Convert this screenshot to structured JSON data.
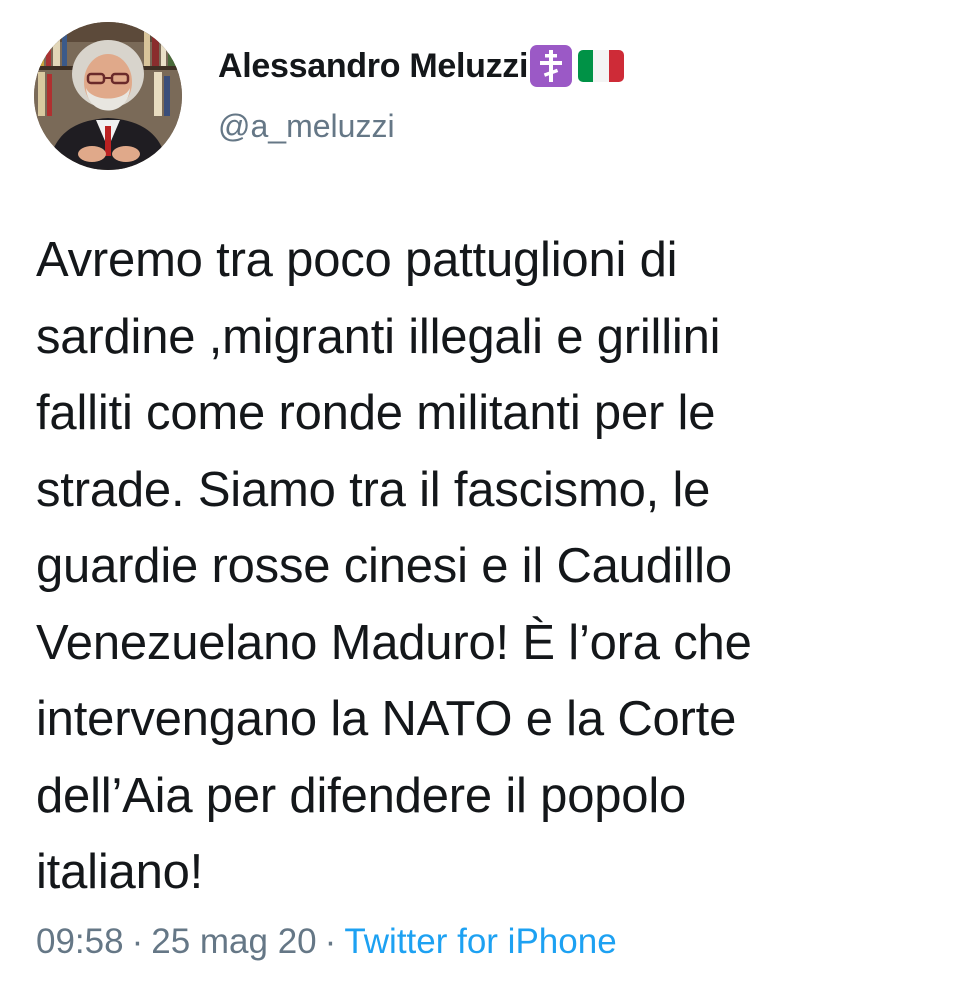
{
  "author": {
    "display_name": "Alessandro Meluzzi",
    "handle": "@a_meluzzi",
    "badges": [
      "orthodox-cross-emoji",
      "italy-flag-emoji"
    ]
  },
  "tweet": {
    "text": "Avremo tra poco pattuglioni di\nsardine ,migranti illegali e grillini\nfalliti come ronde militanti per le\nstrade. Siamo tra il fascismo, le\nguardie rosse cinesi e il Caudillo\nVenezuelano Maduro! È l’ora che\nintervengano la NATO e la Corte\ndell’Aia per difendere il popolo\nitaliano!"
  },
  "meta": {
    "time": "09:58",
    "separator": "·",
    "date": "25 mag 20",
    "source": "Twitter for iPhone"
  },
  "colors": {
    "text": "#14171a",
    "secondary": "#657786",
    "link": "#1da1f2",
    "cross_badge": "#9b59c6",
    "flag_green": "#009246",
    "flag_white": "#ffffff",
    "flag_red": "#ce2b37"
  }
}
